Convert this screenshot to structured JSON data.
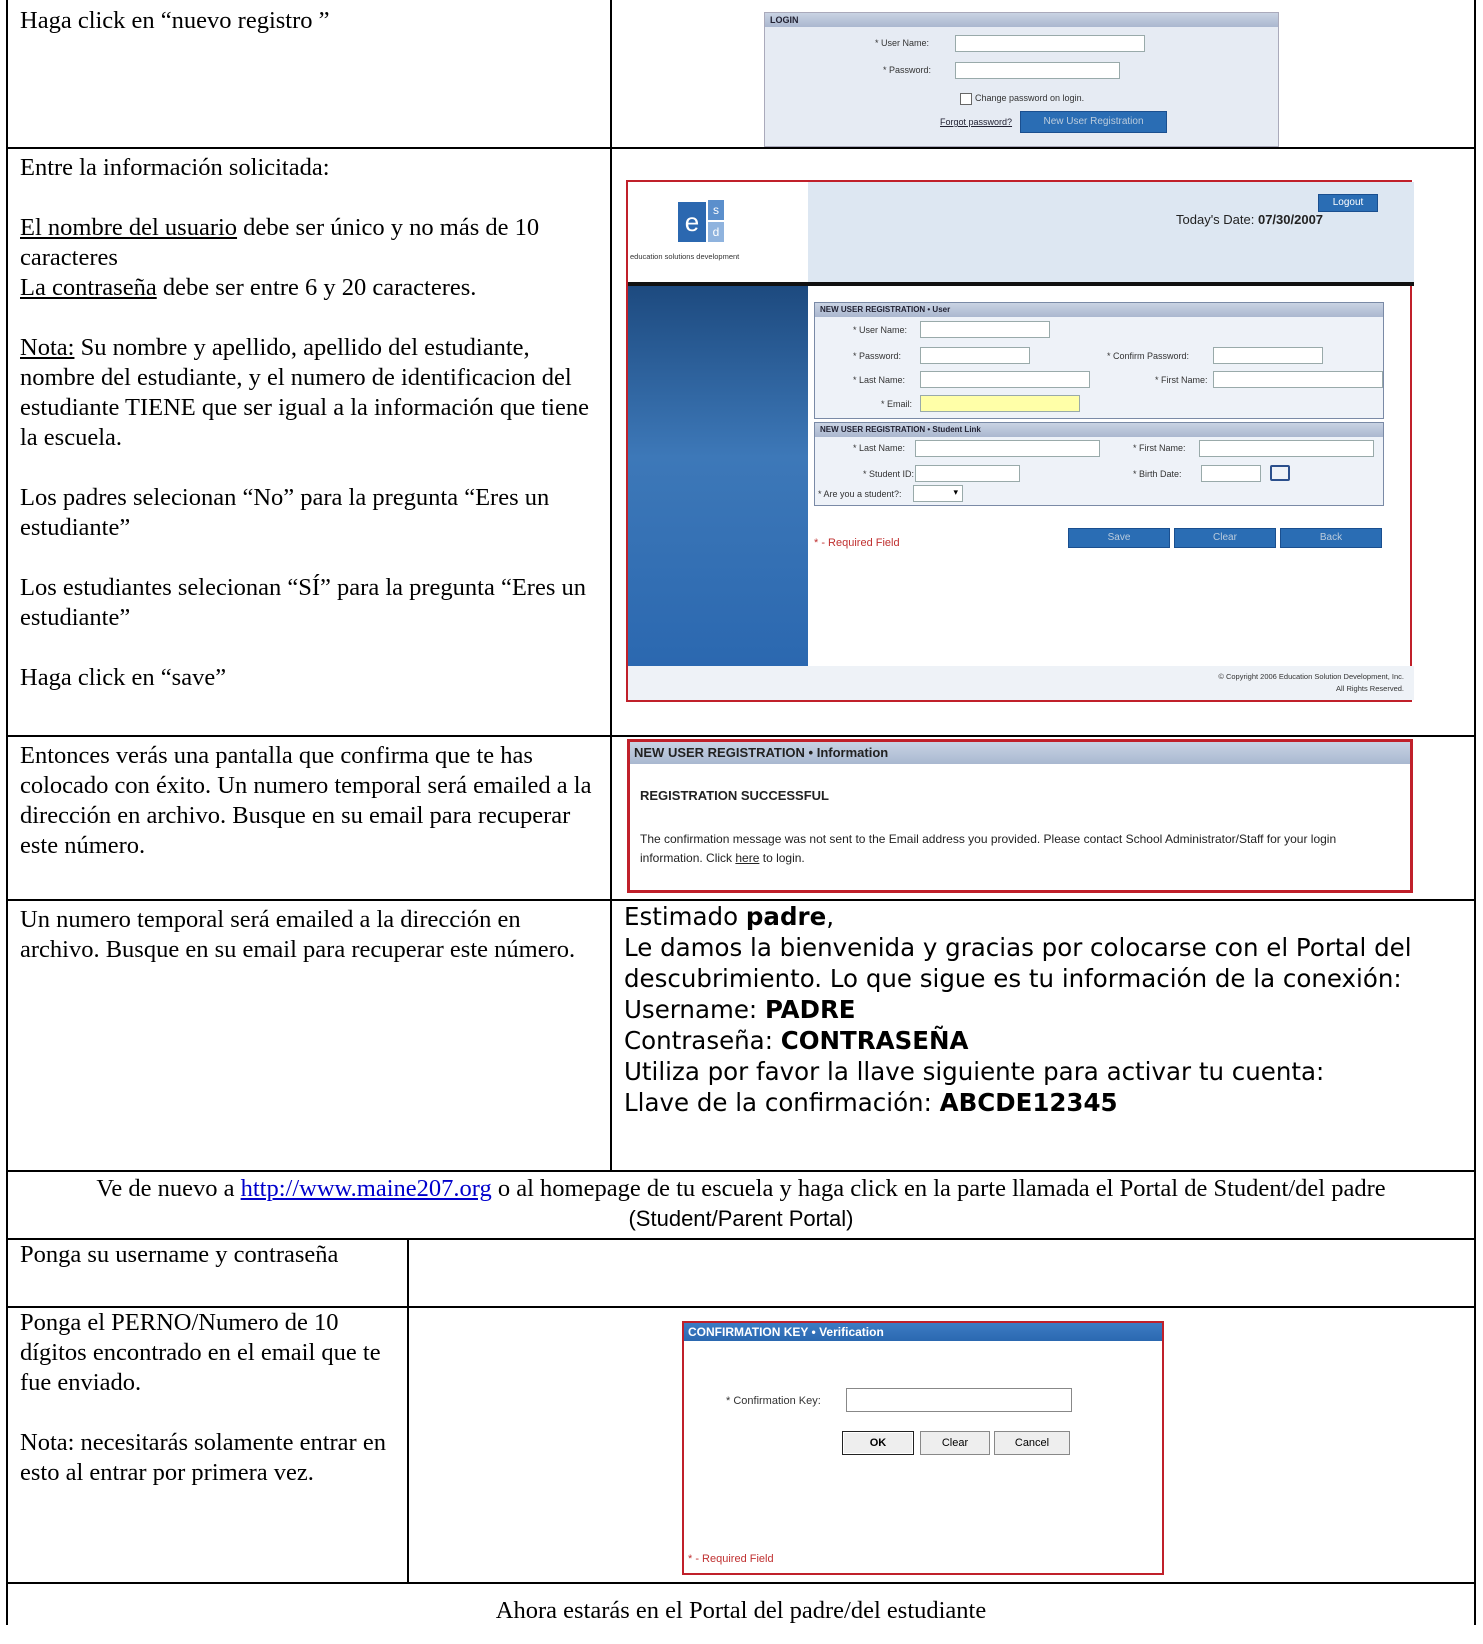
{
  "rows": {
    "r1": {
      "instruction": "Haga click en “nuevo registro ”"
    },
    "r2": {
      "intro": "Entre la información solicitada:",
      "user_label": "El nombre del usuario",
      "user_rest": " debe ser único y no más de 10 caracteres",
      "pass_label": "La contraseña",
      "pass_rest": " debe ser entre 6 y 20 caracteres.",
      "nota_label": "Nota:",
      "nota_rest": " Su nombre y apellido, apellido del estudiante, nombre del estudiante, y el numero de identificacion del estudiante TIENE que ser igual a la información  que tiene la escuela.",
      "parents": "Los padres selecionan “No”  para la pregunta “Eres un estudiante”",
      "students": "Los estudiantes selecionan  “SÍ” para la pregunta “Eres un estudiante”",
      "save": "Haga click en “save”"
    },
    "r3": {
      "text": "Entonces verás una pantalla que confirma que te has colocado con éxito.  Un numero temporal será emailed a la dirección en archivo.  Busque en su email para recuperar este número."
    },
    "r4": {
      "text": "Un numero temporal será emailed a la dirección en archivo.  Busque en su email para recuperar este número.",
      "email": {
        "greet_pre": "Estimado ",
        "greet_bold": "padre",
        "greet_post": ",",
        "welcome": "Le damos la bienvenida y gracias por colocarse con el Portal del descubrimiento. Lo que sigue es tu información de la conexión:",
        "username_label": "Username: ",
        "username_value": "PADRE",
        "password_label": "Contraseña: ",
        "password_value": "CONTRASEÑA",
        "activate": "Utiliza por favor la llave siguiente para activar tu cuenta:",
        "key_label": "Llave de la confirmación: ",
        "key_value": "ABCDE12345"
      }
    },
    "r5": {
      "pre": "Ve de nuevo a ",
      "link": "http://www.maine207.org",
      "mid": " o al homepage de tu escuela y haga click en la parte llamada el Portal de Student/del padre ",
      "sans": "(Student/Parent Portal)"
    },
    "r6": {
      "text": "Ponga su  username y contraseña"
    },
    "r7": {
      "text": "Ponga el PERNO/Numero de 10 dígitos encontrado en el email que te fue enviado.",
      "nota": "Nota: necesitarás solamente entrar en esto al entrar por primera vez."
    },
    "r8": {
      "text": "Ahora estarás en el Portal del padre/del estudiante"
    }
  },
  "login_shot": {
    "header": "LOGIN",
    "user_label": "* User Name:",
    "pass_label": "* Password:",
    "change_pw": "Change password on login.",
    "forgot": "Forgot password?",
    "new_reg": "New User Registration"
  },
  "reg_shot": {
    "logo_letters": [
      "e",
      "s",
      "d"
    ],
    "logo_text": "education solutions development",
    "logout": "Logout",
    "date_label": "Today's Date: ",
    "date_value": "07/30/2007",
    "section_user": "NEW USER REGISTRATION • User",
    "user_name": "* User Name:",
    "password": "* Password:",
    "confirm_password": "* Confirm Password:",
    "last_name": "* Last Name:",
    "first_name": "* First Name:",
    "email": "* Email:",
    "section_student": "NEW USER REGISTRATION • Student Link",
    "s_last_name": "* Last Name:",
    "s_first_name": "* First Name:",
    "student_id": "* Student ID:",
    "birth_date": "* Birth Date:",
    "are_student": "* Are you a student?:",
    "required": "* - Required Field",
    "save": "Save",
    "clear": "Clear",
    "back": "Back",
    "copyright": "© Copyright 2006 Education Solution Development, Inc.",
    "rights": "All Rights Reserved."
  },
  "info_shot": {
    "header": "NEW USER REGISTRATION • Information",
    "success": "REGISTRATION SUCCESSFUL",
    "message": "The confirmation message was not sent to the Email address you provided. Please contact School Administrator/Staff for your login information. Click ",
    "here": "here",
    "message_end": " to login."
  },
  "confirm_shot": {
    "header": "CONFIRMATION KEY • Verification",
    "key_label": "* Confirmation Key:",
    "ok": "OK",
    "clear": "Clear",
    "cancel": "Cancel",
    "required": "* - Required Field"
  },
  "colors": {
    "blue_header": "#2b68b0",
    "red_border": "#c0202a",
    "sidebar_blue": "#26588f"
  }
}
